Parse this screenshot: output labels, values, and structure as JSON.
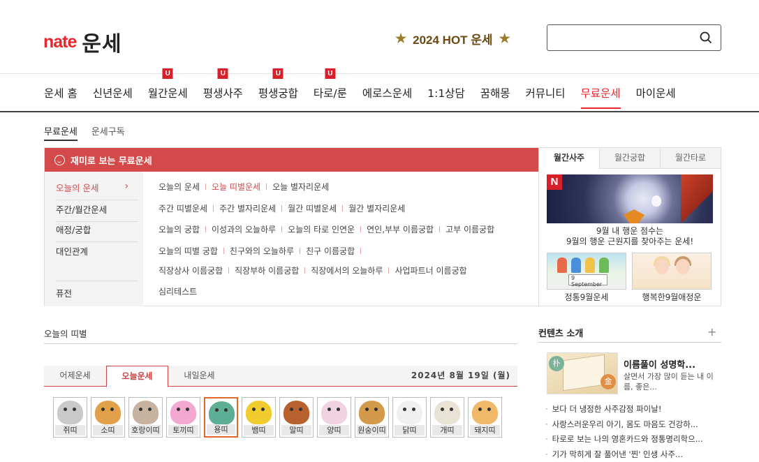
{
  "header": {
    "logo_brand": "nate",
    "logo_service": "운세",
    "hot_label": "2024 HOT 운세",
    "search_placeholder": ""
  },
  "gnb": [
    {
      "label": "운세 홈",
      "badge": ""
    },
    {
      "label": "신년운세",
      "badge": ""
    },
    {
      "label": "월간운세",
      "badge": "U"
    },
    {
      "label": "평생사주",
      "badge": "U"
    },
    {
      "label": "평생궁합",
      "badge": "U"
    },
    {
      "label": "타로/룬",
      "badge": "U"
    },
    {
      "label": "에로스운세",
      "badge": ""
    },
    {
      "label": "1:1상담",
      "badge": ""
    },
    {
      "label": "꿈해몽",
      "badge": ""
    },
    {
      "label": "커뮤니티",
      "badge": ""
    },
    {
      "label": "무료운세",
      "badge": "",
      "active": true
    },
    {
      "label": "마이운세",
      "badge": ""
    }
  ],
  "subnav": [
    {
      "label": "무료운세",
      "active": true
    },
    {
      "label": "운세구독",
      "active": false
    }
  ],
  "freebox": {
    "title": "재미로 보는 무료운세",
    "categories": [
      "오늘의 운세",
      "주간/월간운세",
      "애정/궁합",
      "대인관계",
      "퓨전"
    ],
    "rows": [
      [
        "오늘의 운세",
        "오늘 띠별운세",
        "오늘 별자리운세"
      ],
      [
        "주간 띠별운세",
        "주간 별자리운세",
        "월간 띠별운세",
        "월간 별자리운세"
      ],
      [
        "오늘의 궁합",
        "이성과의 오늘하루",
        "오늘의 타로 인연운",
        "연인,부부 이름궁합",
        "고부 이름궁합"
      ],
      [
        "오늘의 띠별 궁합",
        "친구와의 오늘하루",
        "친구 이름궁합"
      ],
      [
        "직장상사 이름궁합",
        "직장부하 이름궁합",
        "직장에서의 오늘하루",
        "사업파트너 이름궁합"
      ],
      [
        "심리테스트"
      ]
    ]
  },
  "rpanel": {
    "tabs": [
      "월간사주",
      "월간궁합",
      "월간타로"
    ],
    "banner_badge": "N",
    "banner_line1": "9월 내 행운 점수는",
    "banner_line2": "9월의 행운 근원지를 찾아주는 운세!",
    "thumb1_label": "정통9월운세",
    "thumb1_calendar": "9 September",
    "thumb2_label": "행복한9월애정운"
  },
  "tti": {
    "title": "오늘의 띠별",
    "tabs": [
      "어제운세",
      "오늘운세",
      "내일운세"
    ],
    "date": "2024년 8월 19일 (월)",
    "animals": [
      {
        "name": "쥐띠",
        "color": "#c9c9c9"
      },
      {
        "name": "소띠",
        "color": "#e2a04a"
      },
      {
        "name": "호랑이띠",
        "color": "#c7b3a0"
      },
      {
        "name": "토끼띠",
        "color": "#f2a8d1"
      },
      {
        "name": "용띠",
        "color": "#5cae95"
      },
      {
        "name": "뱀띠",
        "color": "#f1cc2e"
      },
      {
        "name": "말띠",
        "color": "#b8612e"
      },
      {
        "name": "양띠",
        "color": "#f0d2e0"
      },
      {
        "name": "원숭이띠",
        "color": "#d29a4a"
      },
      {
        "name": "닭띠",
        "color": "#f0f0f0"
      },
      {
        "name": "개띠",
        "color": "#e9e3d6"
      },
      {
        "name": "돼지띠",
        "color": "#f0b96a"
      }
    ]
  },
  "contents": {
    "title": "컨텐츠 소개",
    "plus": "+",
    "book_char1": "朴",
    "book_char2": "金",
    "feature_title": "이름풀이 성명학...",
    "feature_desc": "살면서 가장 많이 듣는 내 이름, 좋은...",
    "list": [
      "보다 더 냉정한 사주감정 파이날!",
      "사랑스러운우리 아기, 몸도 마음도 건강하...",
      "타로로 보는 나의 영혼카드와 정통명리학으...",
      "기가 막히게 잘 풀어낸 '찐' 인생 사주..."
    ]
  }
}
